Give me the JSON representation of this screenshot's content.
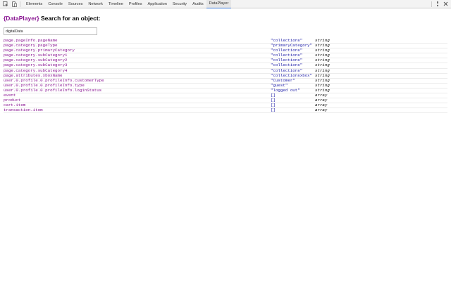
{
  "devtools": {
    "tabs": [
      {
        "label": "Elements",
        "active": false
      },
      {
        "label": "Console",
        "active": false
      },
      {
        "label": "Sources",
        "active": false
      },
      {
        "label": "Network",
        "active": false
      },
      {
        "label": "Timeline",
        "active": false
      },
      {
        "label": "Profiles",
        "active": false
      },
      {
        "label": "Application",
        "active": false
      },
      {
        "label": "Security",
        "active": false
      },
      {
        "label": "Audits",
        "active": false
      },
      {
        "label": "DataPlayer",
        "active": true
      }
    ],
    "active_color": "#3879d9"
  },
  "panel": {
    "brand": "{DataPlayer}",
    "title": "Search for an object:",
    "search_value": "digitalData",
    "rows": [
      {
        "path": "page.pageInfo.pageName",
        "value": "\"collections\"",
        "type": "string"
      },
      {
        "path": "page.category.pageType",
        "value": "\"primaryCategory\"",
        "type": "string"
      },
      {
        "path": "page.category.primaryCategory",
        "value": "\"collections\"",
        "type": "string"
      },
      {
        "path": "page.category.subCategory1",
        "value": "\"collections\"",
        "type": "string"
      },
      {
        "path": "page.category.subCategory2",
        "value": "\"collections\"",
        "type": "string"
      },
      {
        "path": "page.category.subCategory3",
        "value": "\"collections\"",
        "type": "string"
      },
      {
        "path": "page.category.subCategory4",
        "value": "\"collections\"",
        "type": "string"
      },
      {
        "path": "page.attributes.xboxName",
        "value": "\"collectionsxbox\"",
        "type": "string"
      },
      {
        "path": "user.0.profile.0.profileInfo.customerType",
        "value": "\"Customer\"",
        "type": "string"
      },
      {
        "path": "user.0.profile.0.profileInfo.type",
        "value": "\"guest\"",
        "type": "string"
      },
      {
        "path": "user.0.profile.0.profileInfo.loginStatus",
        "value": "\"logged out\"",
        "type": "string"
      },
      {
        "path": "event",
        "value": "[]",
        "type": "array"
      },
      {
        "path": "product",
        "value": "[]",
        "type": "array"
      },
      {
        "path": "cart.item",
        "value": "[]",
        "type": "array"
      },
      {
        "path": "transaction.item",
        "value": "[]",
        "type": "array"
      }
    ],
    "colors": {
      "path": "#881391",
      "value": "#1a1aa6",
      "type": "#000000"
    }
  }
}
